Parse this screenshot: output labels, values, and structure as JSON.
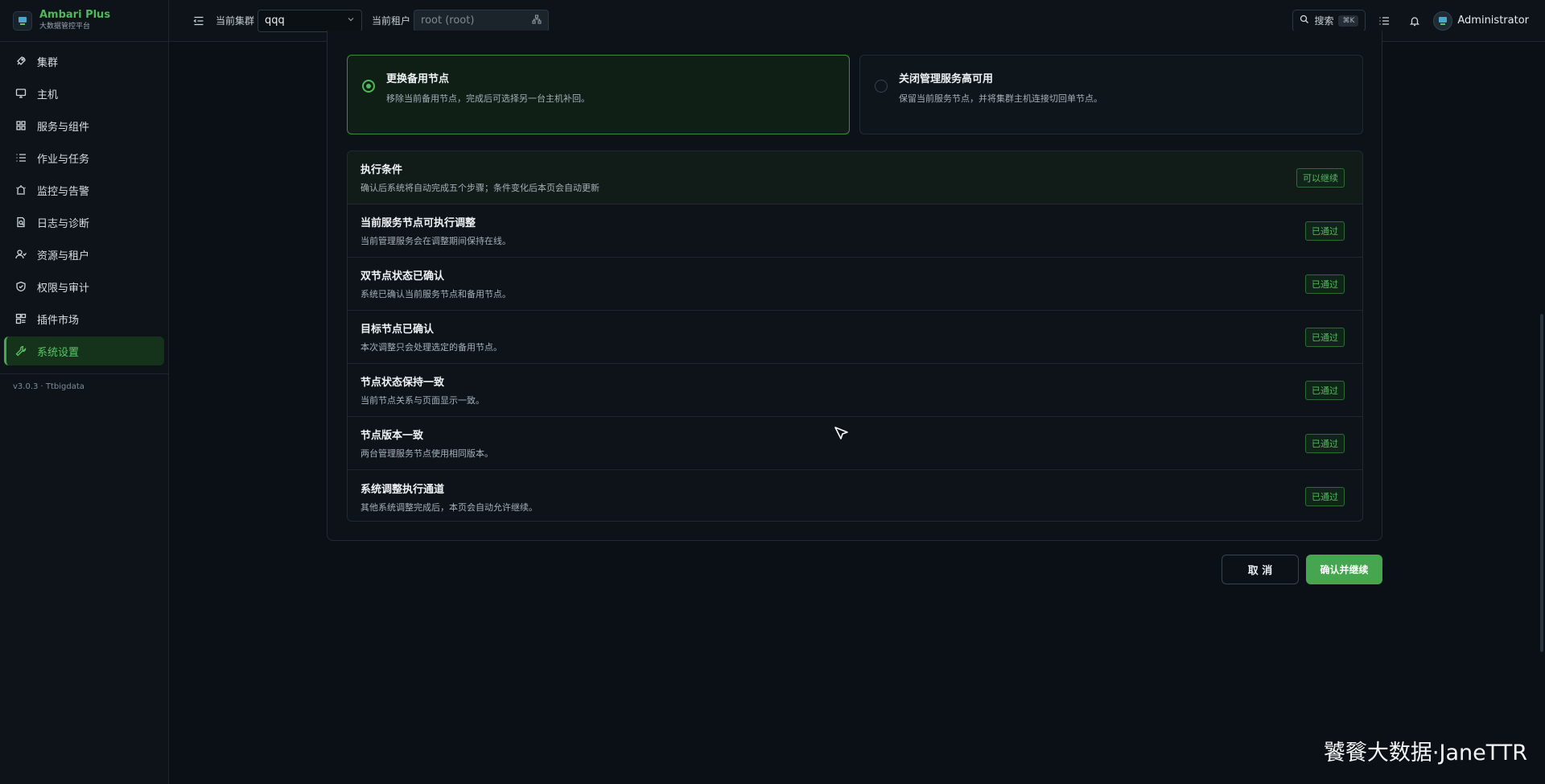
{
  "brand": {
    "name": "Ambari Plus",
    "subtitle": "大数据管控平台"
  },
  "sidebar": {
    "items": [
      {
        "label": "集群",
        "icon": "rocket-icon",
        "active": false
      },
      {
        "label": "主机",
        "icon": "monitor-icon",
        "active": false
      },
      {
        "label": "服务与组件",
        "icon": "grid-icon",
        "active": false
      },
      {
        "label": "作业与任务",
        "icon": "list-icon",
        "active": false
      },
      {
        "label": "监控与告警",
        "icon": "siren-icon",
        "active": false
      },
      {
        "label": "日志与诊断",
        "icon": "file-search-icon",
        "active": false
      },
      {
        "label": "资源与租户",
        "icon": "users-icon",
        "active": false
      },
      {
        "label": "权限与审计",
        "icon": "shield-icon",
        "active": false
      },
      {
        "label": "插件市场",
        "icon": "blocks-icon",
        "active": false
      },
      {
        "label": "系统设置",
        "icon": "wrench-icon",
        "active": true
      }
    ],
    "version": "v3.0.3 · Ttbigdata"
  },
  "topbar": {
    "cluster_label": "当前集群",
    "cluster_value": "qqq",
    "tenant_label": "当前租户",
    "tenant_value": "root (root)",
    "search_label": "搜索",
    "search_shortcut": "⌘K",
    "user_name": "Administrator"
  },
  "options": [
    {
      "title": "更换备用节点",
      "desc": "移除当前备用节点，完成后可选择另一台主机补回。",
      "selected": true
    },
    {
      "title": "关闭管理服务高可用",
      "desc": "保留当前服务节点，并将集群主机连接切回单节点。",
      "selected": false
    }
  ],
  "checklist": {
    "header": {
      "title": "执行条件",
      "desc": "确认后系统将自动完成五个步骤；条件变化后本页会自动更新",
      "badge": "可以继续"
    },
    "rows": [
      {
        "title": "当前服务节点可执行调整",
        "desc": "当前管理服务会在调整期间保持在线。",
        "badge": "已通过"
      },
      {
        "title": "双节点状态已确认",
        "desc": "系统已确认当前服务节点和备用节点。",
        "badge": "已通过"
      },
      {
        "title": "目标节点已确认",
        "desc": "本次调整只会处理选定的备用节点。",
        "badge": "已通过"
      },
      {
        "title": "节点状态保持一致",
        "desc": "当前节点关系与页面显示一致。",
        "badge": "已通过"
      },
      {
        "title": "节点版本一致",
        "desc": "两台管理服务节点使用相同版本。",
        "badge": "已通过"
      },
      {
        "title": "系统调整执行通道",
        "desc": "其他系统调整完成后，本页会自动允许继续。",
        "badge": "已通过"
      }
    ]
  },
  "actions": {
    "cancel": "取 消",
    "confirm": "确认并继续"
  },
  "watermark": "饕餮大数据·JaneTTR",
  "colors": {
    "accent": "#46a64f",
    "active_nav_bg": "#15321b",
    "background": "#0b1016"
  }
}
